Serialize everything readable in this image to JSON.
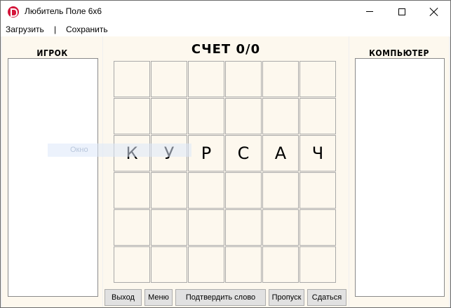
{
  "window": {
    "title": "Любитель Поле 6x6"
  },
  "menu": {
    "load": "Загрузить",
    "separator": "|",
    "save": "Сохранить"
  },
  "player": {
    "title": "ИГРОК",
    "words": []
  },
  "computer": {
    "title": "КОМПЬЮТЕР",
    "words": []
  },
  "score": {
    "text": "СЧЕТ 0/0"
  },
  "board": {
    "rows": [
      [
        "",
        "",
        "",
        "",
        "",
        ""
      ],
      [
        "",
        "",
        "",
        "",
        "",
        ""
      ],
      [
        "К",
        "У",
        "Р",
        "С",
        "А",
        "Ч"
      ],
      [
        "",
        "",
        "",
        "",
        "",
        ""
      ],
      [
        "",
        "",
        "",
        "",
        "",
        ""
      ],
      [
        "",
        "",
        "",
        "",
        "",
        ""
      ]
    ]
  },
  "overlay": {
    "ghost_label": "Окно"
  },
  "buttons": {
    "exit": "Выход",
    "menu": "Меню",
    "confirm": "Подтвердить слово",
    "skip": "Пропуск",
    "give_up": "Сдаться"
  },
  "colors": {
    "panel_bg": "#fdf8ee",
    "cell_border": "#a9a9a9",
    "app_icon": "#d4163b"
  }
}
